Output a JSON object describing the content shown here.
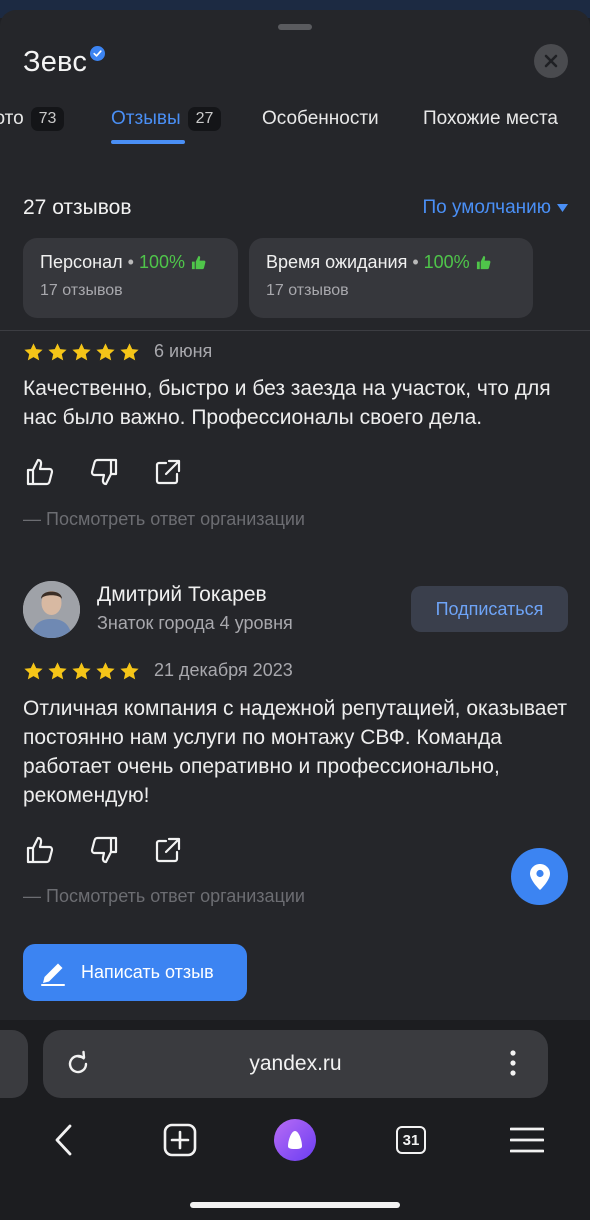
{
  "place": {
    "title": "Зевс"
  },
  "tabs": [
    {
      "label": "Фото",
      "count": "73"
    },
    {
      "label": "Отзывы",
      "count": "27",
      "active": true
    },
    {
      "label": "Особенности"
    },
    {
      "label": "Похожие места"
    }
  ],
  "reviews_header": {
    "count_label": "27 отзывов",
    "sort_label": "По умолчанию"
  },
  "aspects": [
    {
      "name": "Персонал",
      "percent": "100%",
      "reviews": "17 отзывов"
    },
    {
      "name": "Время ожидания",
      "percent": "100%",
      "reviews": "17 отзывов"
    }
  ],
  "reviews": [
    {
      "rating": 5,
      "date": "6 июня",
      "text": "Качественно, быстро и без заезда на участок, что для нас было важно. Профессионалы своего дела.",
      "org_reply": "—  Посмотреть ответ организации"
    },
    {
      "author": "Дмитрий Токарев",
      "level": "Знаток города 4 уровня",
      "subscribe_label": "Подписаться",
      "rating": 5,
      "date": "21 декабря 2023",
      "text": "Отличная компания с надежной репутацией, оказывает постоянно нам услуги по монтажу СВФ. Команда работает очень оперативно и профессионально, рекомендую!",
      "org_reply": "—  Посмотреть ответ организации"
    }
  ],
  "write_review_label": "Написать отзыв",
  "browser": {
    "url": "yandex.ru",
    "tabs_count": "31"
  },
  "colors": {
    "accent": "#3c84f2",
    "positive": "#4fc54a",
    "star": "#f5c518",
    "background": "#25262a"
  }
}
